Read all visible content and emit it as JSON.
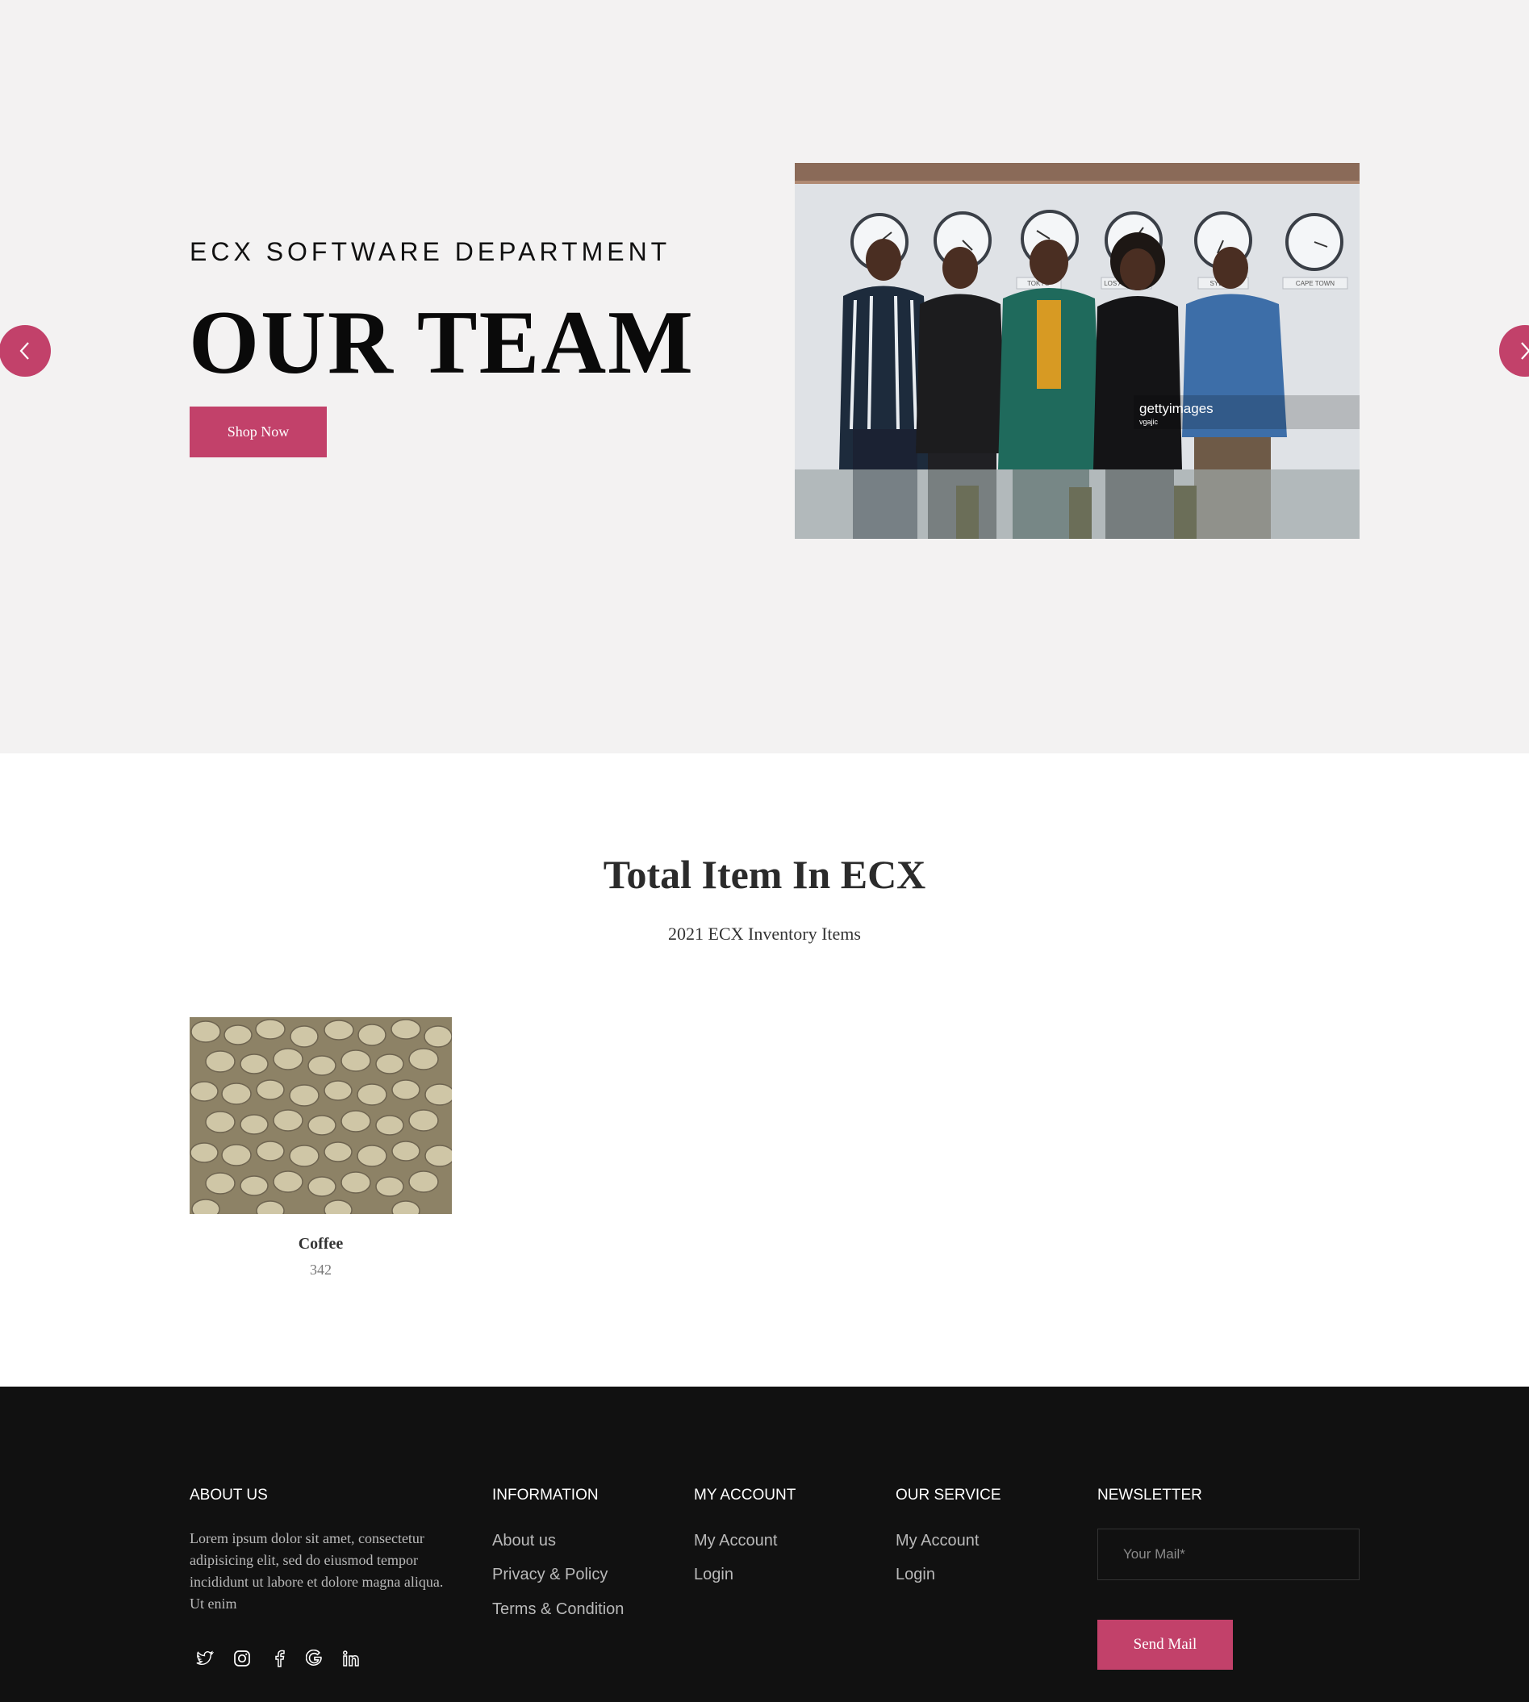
{
  "hero": {
    "eyebrow": "ECX SOFTWARE DEPARTMENT",
    "title": "OUR TEAM",
    "button_label": "Shop Now",
    "photo_watermark": "gettyimages",
    "photo_credit": "vgajic",
    "clock_labels": [
      "TOKYO",
      "LOS ANGELES",
      "SYDNEY",
      "CAPE TOWN"
    ],
    "prev_icon": "chevron-left-icon",
    "next_icon": "chevron-right-icon"
  },
  "inventory": {
    "title": "Total Item In ECX",
    "subtitle": "2021 ECX Inventory Items",
    "items": [
      {
        "name": "Coffee",
        "count": "342"
      }
    ]
  },
  "footer": {
    "about": {
      "heading": "ABOUT US",
      "text": "Lorem ipsum dolor sit amet, consectetur adipisicing elit, sed do eiusmod tempor incididunt ut labore et dolore magna aliqua. Ut enim"
    },
    "information": {
      "heading": "INFORMATION",
      "links": [
        "About us",
        "Privacy & Policy",
        "Terms & Condition"
      ]
    },
    "my_account": {
      "heading": "MY ACCOUNT",
      "links": [
        "My Account",
        "Login"
      ]
    },
    "our_service": {
      "heading": "OUR SERVICE",
      "links": [
        "My Account",
        "Login"
      ]
    },
    "newsletter": {
      "heading": "NEWSLETTER",
      "placeholder": "Your Mail*",
      "button_label": "Send Mail"
    },
    "social": [
      "twitter-icon",
      "instagram-icon",
      "facebook-icon",
      "google-icon",
      "linkedin-icon"
    ]
  },
  "colors": {
    "accent": "#c2416a",
    "hero_bg": "#f3f2f2",
    "footer_bg": "#111111"
  }
}
